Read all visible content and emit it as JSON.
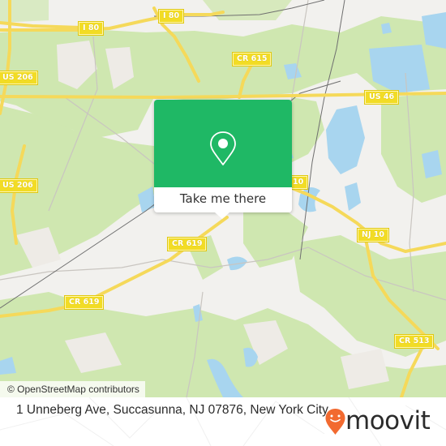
{
  "map": {
    "colors": {
      "land": "#f2f1ee",
      "forest": "#cfe7b0",
      "water": "#a8d5ef",
      "road_major": "#f5d95a",
      "road_minor": "#c9c5c0",
      "rail": "#6f6f6f",
      "shield": "#f2dc25"
    },
    "shields": [
      {
        "id": "i80-west",
        "label": "I 80"
      },
      {
        "id": "i80-east",
        "label": "I 80"
      },
      {
        "id": "us206-north",
        "label": "US 206"
      },
      {
        "id": "us206-south",
        "label": "US 206"
      },
      {
        "id": "cr615",
        "label": "CR 615"
      },
      {
        "id": "us46",
        "label": "US 46"
      },
      {
        "id": "nj10-partial",
        "label": "10"
      },
      {
        "id": "cr619-east",
        "label": "CR 619"
      },
      {
        "id": "cr619-west",
        "label": "CR 619"
      },
      {
        "id": "nj10",
        "label": "NJ 10"
      },
      {
        "id": "cr513",
        "label": "CR 513"
      }
    ],
    "attribution": "© OpenStreetMap contributors"
  },
  "popup": {
    "icon": "map-pin-icon",
    "button_label": "Take me there",
    "color": "#1fb865"
  },
  "footer": {
    "address": "1 Unneberg Ave, Succasunna, NJ 07876, New York City",
    "brand": {
      "name": "moovit",
      "icon": "moovit-logo-pin-icon",
      "color": "#f26a30"
    }
  }
}
